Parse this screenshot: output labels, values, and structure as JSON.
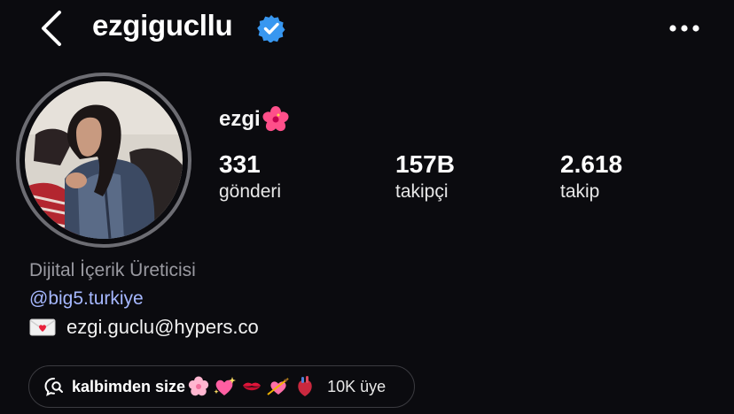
{
  "header": {
    "username": "ezgigucllu",
    "back_icon": "chevron-left-icon",
    "verified_icon": "verified-badge-icon",
    "more_icon": "more-horizontal-icon"
  },
  "profile": {
    "display_name": "ezgi",
    "name_emoji": "hibiscus-icon",
    "stats": [
      {
        "value": "331",
        "label": "gönderi"
      },
      {
        "value": "157B",
        "label": "takipçi"
      },
      {
        "value": "2.618",
        "label": "takip"
      }
    ],
    "category": "Dijital İçerik Üreticisi",
    "link": "@big5.turkiye",
    "email": "ezgi.guclu@hypers.co",
    "email_icon": "love-letter-icon"
  },
  "channel": {
    "icon": "broadcast-channel-icon",
    "title": "kalbimden size",
    "emojis": [
      "cherry-blossom-icon",
      "sparkling-heart-icon",
      "kiss-mark-icon",
      "heart-with-arrow-icon",
      "anatomical-heart-icon"
    ],
    "member_count": "10K üye"
  },
  "colors": {
    "background": "#0b0b0f",
    "verified": "#3897f0",
    "link": "#a6b8ff",
    "muted": "#9a9aa1"
  }
}
